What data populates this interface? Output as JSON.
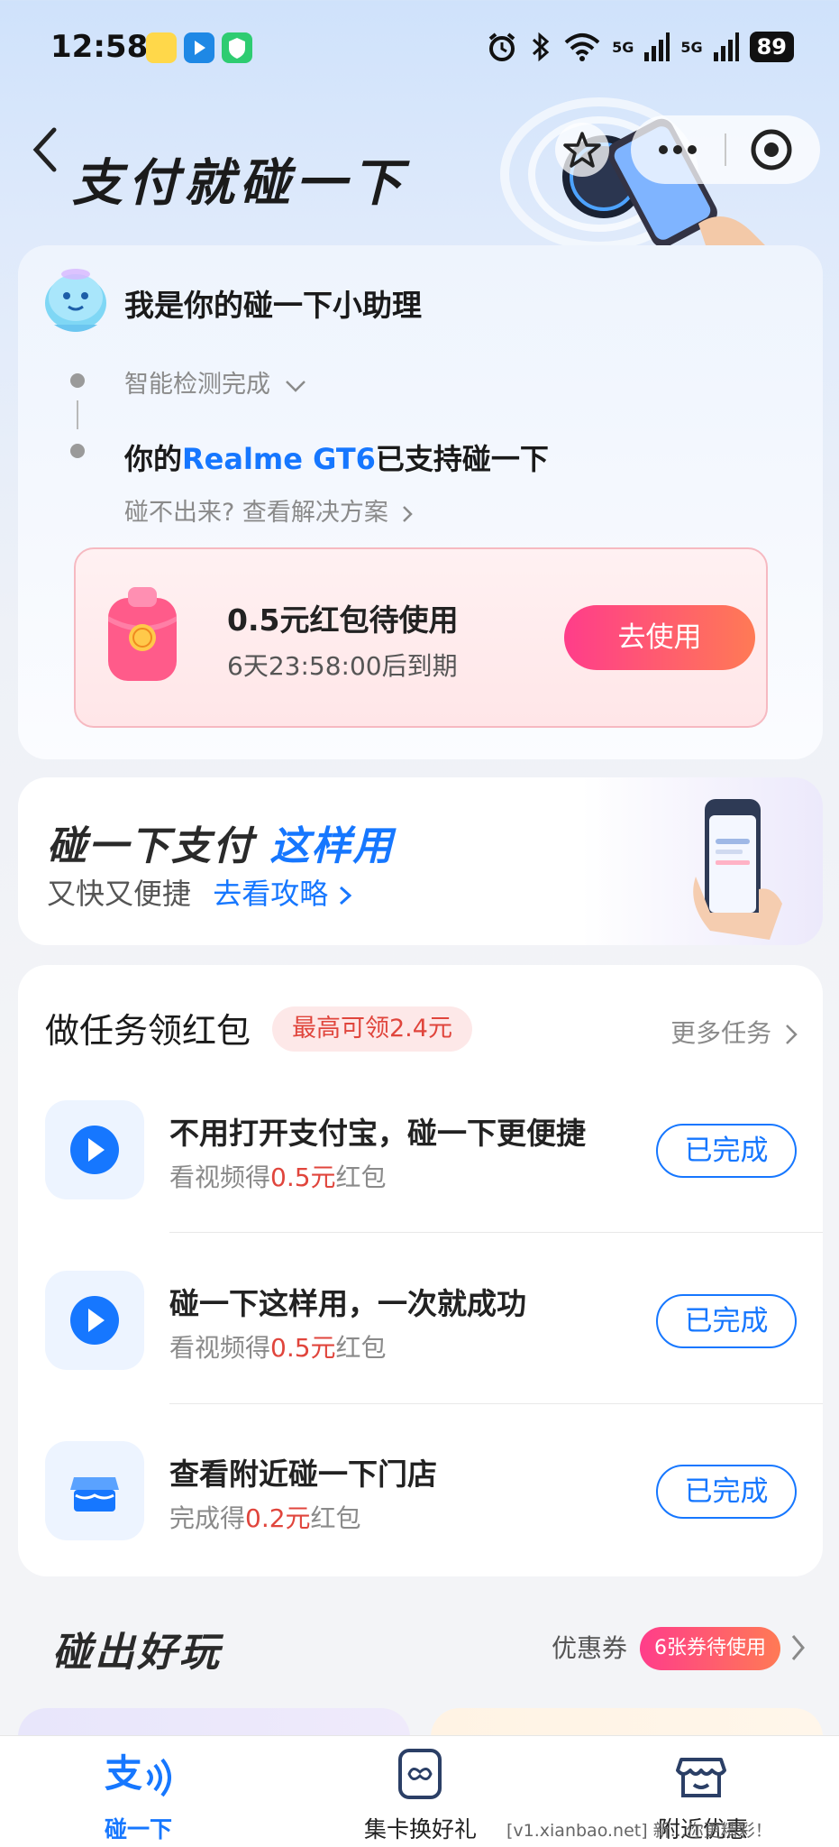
{
  "status_bar": {
    "time": "12:58",
    "signal1": "5G",
    "signal2": "5G",
    "battery": "89"
  },
  "header": {
    "title": "支付就碰一下"
  },
  "assistant": {
    "title": "我是你的碰一下小助理",
    "detect_status": "智能检测完成",
    "support_prefix": "你的",
    "device_name": "Realme GT6",
    "support_suffix": "已支持碰一下",
    "help_link": "碰不出来? 查看解决方案"
  },
  "red_packet": {
    "title": "0.5元红包待使用",
    "expiry": "6天23:58:00后到期",
    "button": "去使用"
  },
  "guide": {
    "title_main": "碰一下支付 ",
    "title_highlight": "这样用",
    "subtitle": "又快又便捷",
    "link": "去看攻略"
  },
  "tasks": {
    "title": "做任务领红包",
    "badge": "最高可领2.4元",
    "more": "更多任务",
    "items": [
      {
        "title": "不用打开支付宝，碰一下更便捷",
        "sub_prefix": "看视频得",
        "amount": "0.5元",
        "sub_suffix": "红包",
        "button": "已完成",
        "icon": "play-icon"
      },
      {
        "title": "碰一下这样用，一次就成功",
        "sub_prefix": "看视频得",
        "amount": "0.5元",
        "sub_suffix": "红包",
        "button": "已完成",
        "icon": "play-icon"
      },
      {
        "title": "查看附近碰一下门店",
        "sub_prefix": "完成得",
        "amount": "0.2元",
        "sub_suffix": "红包",
        "button": "已完成",
        "icon": "store-icon"
      }
    ]
  },
  "play": {
    "title": "碰出好玩",
    "coupon_label": "优惠券",
    "coupon_badge": "6张券待使用"
  },
  "tabbar": {
    "items": [
      {
        "label": "碰一下",
        "icon": "alipay-tap-icon",
        "active": true
      },
      {
        "label": "集卡换好礼",
        "icon": "card-icon",
        "active": false
      },
      {
        "label": "附近优惠",
        "icon": "shop-icon",
        "active": false
      }
    ]
  },
  "watermark": "[v1.xianbao.net] 新...你更精彩！",
  "colors": {
    "accent": "#1677ff",
    "red": "#e0453c",
    "gradient_start": "#ff3d8a",
    "gradient_end": "#ff7a55"
  }
}
